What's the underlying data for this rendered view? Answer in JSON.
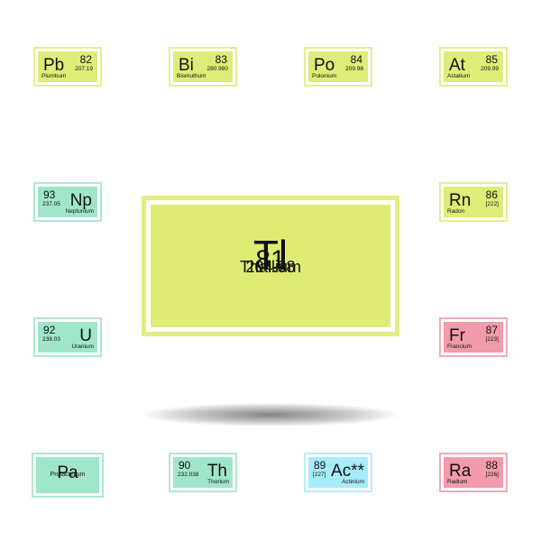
{
  "featured_element": {
    "symbol": "Tl",
    "number": "81",
    "mass": "204.38",
    "name": "Thallium",
    "color": "#dfec73"
  },
  "tiles": [
    {
      "symbol": "Pb",
      "number": "82",
      "mass": "207.19",
      "name": "Plumbum",
      "color": "#dfec78"
    },
    {
      "symbol": "Bi",
      "number": "83",
      "mass": "280.980",
      "name": "Bismuthum",
      "color": "#dfec78"
    },
    {
      "symbol": "Po",
      "number": "84",
      "mass": "209.98",
      "name": "Polonium",
      "color": "#dfec78"
    },
    {
      "symbol": "At",
      "number": "85",
      "mass": "209.99",
      "name": "Astatium",
      "color": "#dfec78"
    },
    {
      "symbol": "Np",
      "number": "93",
      "mass": "237.05",
      "name": "Neptunium",
      "color": "#9fe6cb"
    },
    {
      "symbol": "Rn",
      "number": "86",
      "mass": "[222]",
      "name": "Radon",
      "color": "#dfec78"
    },
    {
      "symbol": "U",
      "number": "92",
      "mass": "238.03",
      "name": "Uranium",
      "color": "#9fe6cb"
    },
    {
      "symbol": "Fr",
      "number": "87",
      "mass": "[223]",
      "name": "Francium",
      "color": "#f29bab"
    },
    {
      "symbol": "Pa",
      "number": "",
      "mass": "",
      "name": "Protactinium",
      "color": "#9fe6cb"
    },
    {
      "symbol": "Th",
      "number": "90",
      "mass": "232.038",
      "name": "Thorium",
      "color": "#9fe6cb"
    },
    {
      "symbol": "Ac**",
      "number": "89",
      "mass": "[227]",
      "name": "Actinium",
      "color": "#a6ecf9"
    },
    {
      "symbol": "Ra",
      "number": "88",
      "mass": "[226]",
      "name": "Radium",
      "color": "#f29bab"
    }
  ]
}
